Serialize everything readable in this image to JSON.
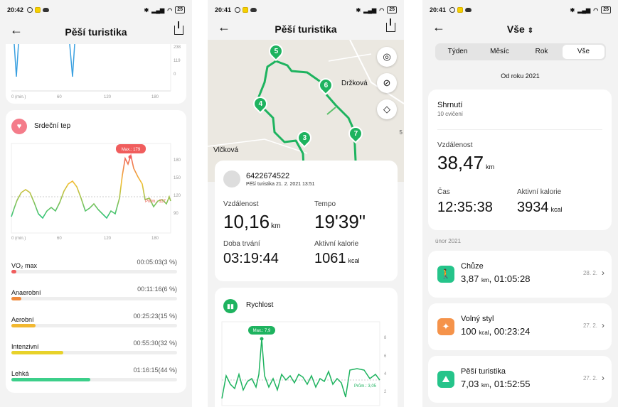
{
  "status": {
    "time": "20:42",
    "time2": "20:41",
    "time3": "20:41",
    "battery": "25"
  },
  "panel1": {
    "title": "Pěší turistika",
    "top_chart": {
      "y_ticks": [
        "238",
        "119",
        "0"
      ],
      "x_ticks": [
        "0 (min.)",
        "60",
        "120",
        "180"
      ]
    },
    "hr_card": {
      "title": "Srdeční tep",
      "max_label": "Max.: 179",
      "avg_label": "Prům.: 117",
      "y_ticks": [
        "180",
        "150",
        "120",
        "90"
      ],
      "x_ticks": [
        "0 (min.)",
        "60",
        "120",
        "180"
      ]
    },
    "zones": [
      {
        "name": "VO₂ max",
        "value": "00:05:03(3 %)",
        "fraction": 0.03,
        "color": "#f05d5d"
      },
      {
        "name": "Anaerobní",
        "value": "00:11:16(6 %)",
        "fraction": 0.06,
        "color": "#f08a3c"
      },
      {
        "name": "Aerobní",
        "value": "00:25:23(15 %)",
        "fraction": 0.15,
        "color": "#f2b830"
      },
      {
        "name": "Intenzivní",
        "value": "00:55:30(32 %)",
        "fraction": 0.32,
        "color": "#e8d22a"
      },
      {
        "name": "Lehká",
        "value": "01:16:15(44 %)",
        "fraction": 0.44,
        "color": "#3ccf8a"
      }
    ]
  },
  "panel2": {
    "title": "Pěší turistika",
    "map_labels": {
      "place1": "Držková",
      "place2": "Vlčková",
      "edge": "5"
    },
    "pins": [
      "5",
      "6",
      "4",
      "3",
      "7"
    ],
    "user": {
      "name": "6422674522",
      "subtitle": "Pěší turistika 21. 2. 2021 13:51"
    },
    "stats": [
      {
        "label": "Vzdálenost",
        "value": "10,16",
        "unit": "km"
      },
      {
        "label": "Tempo",
        "value": "19'39\"",
        "unit": ""
      },
      {
        "label": "Doba trvání",
        "value": "03:19:44",
        "unit": ""
      },
      {
        "label": "Aktivní kalorie",
        "value": "1061",
        "unit": "kcal"
      }
    ],
    "speed": {
      "title": "Rychlost",
      "max_label": "Max.: 7,9",
      "avg_label": "Prům.: 3,05",
      "y_ticks": [
        "8",
        "6",
        "4",
        "2"
      ]
    }
  },
  "panel3": {
    "title": "Vše",
    "tabs": [
      "Týden",
      "Měsíc",
      "Rok",
      "Vše"
    ],
    "since": "Od roku 2021",
    "summary": {
      "title": "Shrnutí",
      "count": "10 cvičení",
      "distance_label": "Vzdálenost",
      "distance_value": "38,47",
      "distance_unit": "km",
      "time_label": "Čas",
      "time_value": "12:35:38",
      "cal_label": "Aktivní kalorie",
      "cal_value": "3934",
      "cal_unit": "kcal"
    },
    "month": "únor 2021",
    "activities": [
      {
        "name": "Chůze",
        "v1": "3,87",
        "u1": "km",
        "v2": "01:05:28",
        "date": "28. 2.",
        "color": "#25c48a",
        "icon": "walk-icon"
      },
      {
        "name": "Volný styl",
        "v1": "100",
        "u1": "kcal",
        "v2": "00:23:24",
        "date": "27. 2.",
        "color": "#f5934a",
        "icon": "freestyle-icon"
      },
      {
        "name": "Pěší turistika",
        "v1": "7,03",
        "u1": "km",
        "v2": "01:52:55",
        "date": "27. 2.",
        "color": "#25c48a",
        "icon": "hiking-icon"
      }
    ]
  }
}
